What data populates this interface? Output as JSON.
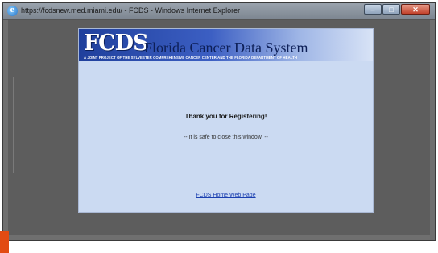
{
  "window": {
    "title": "https://fcdsnew.med.miami.edu/ - FCDS - Windows Internet Explorer",
    "buttons": {
      "minimize": "–",
      "maximize": "□",
      "close": "✕"
    },
    "icon": "ie-icon"
  },
  "page": {
    "logo_text": "FCDS",
    "brand_text": "Florida Cancer Data System",
    "tagline": "A JOINT PROJECT OF THE SYLVESTER COMPREHENSIVE CANCER CENTER AND THE FLORIDA DEPARTMENT OF HEALTH",
    "thanks": "Thank you for Registering!",
    "safe_message": "-- It is safe to close this window. --",
    "home_link": "FCDS Home Web Page"
  },
  "colors": {
    "banner_dark": "#1f3f9c",
    "page_bg": "#cbdaf2",
    "window_bg": "#5d5d5d",
    "link": "#1b3fb0"
  }
}
